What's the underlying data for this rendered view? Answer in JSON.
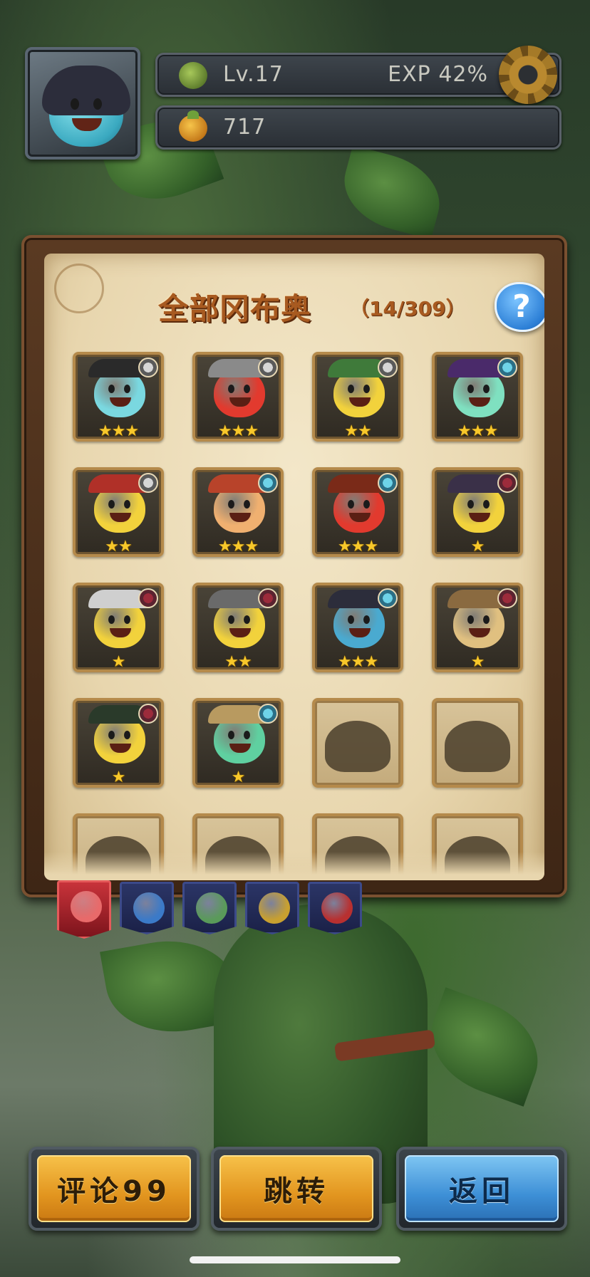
{
  "header": {
    "level": "Lv.17",
    "exp_label": "EXP",
    "exp_value": "42%",
    "exp_fraction": 0.42,
    "coins": "717"
  },
  "collection": {
    "title": "全部冈布奥",
    "count": "（14/309）",
    "owned": 14,
    "total": 309,
    "help_label": "?",
    "cards": [
      {
        "state": "owned",
        "color": "#7ad8e0",
        "badge": "dagger",
        "stars": "★★★"
      },
      {
        "state": "owned",
        "color": "#e23a2e",
        "badge": "dagger",
        "stars": "★★★"
      },
      {
        "state": "owned",
        "color": "#f2d23c",
        "badge": "dagger",
        "stars": "★★"
      },
      {
        "state": "owned",
        "color": "#7fe0c0",
        "badge": "swirl",
        "stars": "★★★"
      },
      {
        "state": "owned",
        "color": "#f2d23c",
        "badge": "dagger",
        "stars": "★★"
      },
      {
        "state": "owned",
        "color": "#f0b070",
        "badge": "swirl",
        "stars": "★★★"
      },
      {
        "state": "owned",
        "color": "#e23a2e",
        "badge": "swirl",
        "stars": "★★★"
      },
      {
        "state": "owned",
        "color": "#f2d23c",
        "badge": "moon",
        "stars": "★"
      },
      {
        "state": "owned",
        "color": "#f2d23c",
        "badge": "moon",
        "stars": "★"
      },
      {
        "state": "owned",
        "color": "#f2d23c",
        "badge": "moon",
        "stars": "★★"
      },
      {
        "state": "owned",
        "color": "#4aaad0",
        "badge": "swirl",
        "stars": "★★★"
      },
      {
        "state": "owned",
        "color": "#e0c080",
        "badge": "moon",
        "stars": "★"
      },
      {
        "state": "owned",
        "color": "#f2d23c",
        "badge": "moon",
        "stars": "★"
      },
      {
        "state": "owned",
        "color": "#5fd0a0",
        "badge": "swirl",
        "stars": "★"
      },
      {
        "state": "locked"
      },
      {
        "state": "locked"
      },
      {
        "state": "locked"
      },
      {
        "state": "locked"
      },
      {
        "state": "locked"
      },
      {
        "state": "locked"
      }
    ]
  },
  "tabs": [
    {
      "name": "all",
      "color": "#e86a6a",
      "active": true
    },
    {
      "name": "blue",
      "color": "#3b7ac8",
      "active": false
    },
    {
      "name": "green",
      "color": "#5a9a5a",
      "active": false
    },
    {
      "name": "gold",
      "color": "#c8a030",
      "active": false
    },
    {
      "name": "red",
      "color": "#b83030",
      "active": false
    }
  ],
  "buttons": {
    "comments": "评论99",
    "jump": "跳转",
    "back": "返回"
  },
  "colors": {
    "gold_button": "#e2951f",
    "blue_button": "#3d8fd6",
    "title_text": "#a85a20",
    "star": "#f8c82a"
  }
}
